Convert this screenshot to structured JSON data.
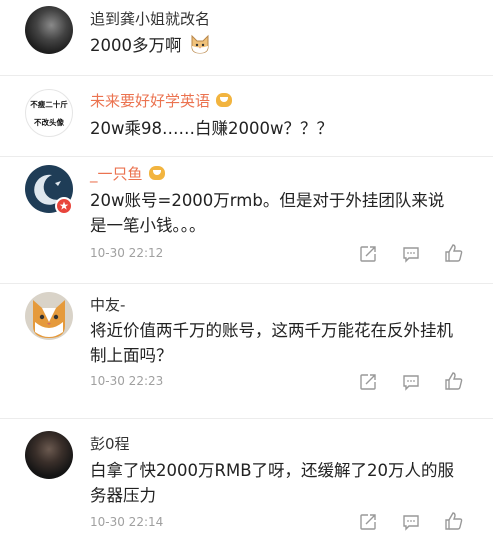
{
  "comments": [
    {
      "username": "追到龚小姐就改名",
      "text": "2000多万啊",
      "emoji": "cat-face-emoji"
    },
    {
      "username": "未来要好好学英语",
      "text": "20w乘98……白赚2000w？？？",
      "avatar_text": [
        "不瘦二十斤",
        "不改头像"
      ]
    },
    {
      "username": "_一只鱼",
      "text_lines": [
        "20w账号=2000万rmb。但是对于外挂团队来说",
        "是一笔小钱。。。"
      ],
      "timestamp": "10-30 22:12"
    },
    {
      "username": "中友-",
      "text_lines": [
        "将近价值两千万的账号，这两千万能花在反外挂机",
        "制上面吗？"
      ],
      "timestamp": "10-30 22:23"
    },
    {
      "username": "彭0程",
      "text_lines": [
        "白拿了快2000万RMB了呀，还缓解了20万人的服",
        "务器压力"
      ],
      "timestamp": "10-30 22:14"
    }
  ],
  "actions": [
    "share-icon",
    "comment-icon",
    "like-icon"
  ],
  "colors": {
    "username_default": "#333333",
    "username_vip": "#eb7350",
    "timestamp": "#a0a0a0",
    "separator": "#ececec"
  }
}
